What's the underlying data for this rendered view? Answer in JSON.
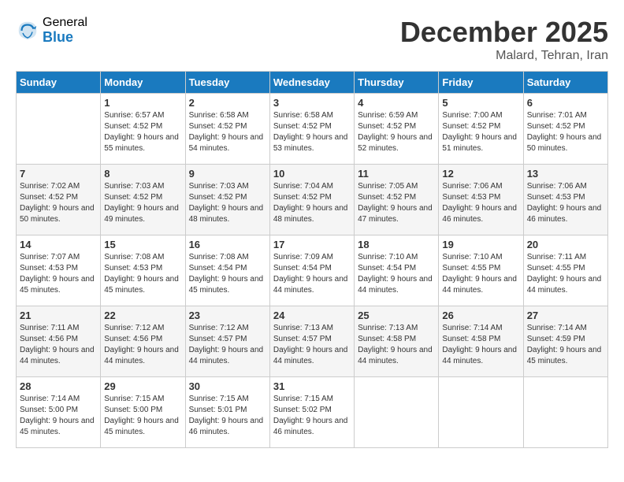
{
  "header": {
    "logo_general": "General",
    "logo_blue": "Blue",
    "month_title": "December 2025",
    "location": "Malard, Tehran, Iran"
  },
  "days_of_week": [
    "Sunday",
    "Monday",
    "Tuesday",
    "Wednesday",
    "Thursday",
    "Friday",
    "Saturday"
  ],
  "weeks": [
    [
      {
        "day": "",
        "sunrise": "",
        "sunset": "",
        "daylight": ""
      },
      {
        "day": "1",
        "sunrise": "Sunrise: 6:57 AM",
        "sunset": "Sunset: 4:52 PM",
        "daylight": "Daylight: 9 hours and 55 minutes."
      },
      {
        "day": "2",
        "sunrise": "Sunrise: 6:58 AM",
        "sunset": "Sunset: 4:52 PM",
        "daylight": "Daylight: 9 hours and 54 minutes."
      },
      {
        "day": "3",
        "sunrise": "Sunrise: 6:58 AM",
        "sunset": "Sunset: 4:52 PM",
        "daylight": "Daylight: 9 hours and 53 minutes."
      },
      {
        "day": "4",
        "sunrise": "Sunrise: 6:59 AM",
        "sunset": "Sunset: 4:52 PM",
        "daylight": "Daylight: 9 hours and 52 minutes."
      },
      {
        "day": "5",
        "sunrise": "Sunrise: 7:00 AM",
        "sunset": "Sunset: 4:52 PM",
        "daylight": "Daylight: 9 hours and 51 minutes."
      },
      {
        "day": "6",
        "sunrise": "Sunrise: 7:01 AM",
        "sunset": "Sunset: 4:52 PM",
        "daylight": "Daylight: 9 hours and 50 minutes."
      }
    ],
    [
      {
        "day": "7",
        "sunrise": "Sunrise: 7:02 AM",
        "sunset": "Sunset: 4:52 PM",
        "daylight": "Daylight: 9 hours and 50 minutes."
      },
      {
        "day": "8",
        "sunrise": "Sunrise: 7:03 AM",
        "sunset": "Sunset: 4:52 PM",
        "daylight": "Daylight: 9 hours and 49 minutes."
      },
      {
        "day": "9",
        "sunrise": "Sunrise: 7:03 AM",
        "sunset": "Sunset: 4:52 PM",
        "daylight": "Daylight: 9 hours and 48 minutes."
      },
      {
        "day": "10",
        "sunrise": "Sunrise: 7:04 AM",
        "sunset": "Sunset: 4:52 PM",
        "daylight": "Daylight: 9 hours and 48 minutes."
      },
      {
        "day": "11",
        "sunrise": "Sunrise: 7:05 AM",
        "sunset": "Sunset: 4:52 PM",
        "daylight": "Daylight: 9 hours and 47 minutes."
      },
      {
        "day": "12",
        "sunrise": "Sunrise: 7:06 AM",
        "sunset": "Sunset: 4:53 PM",
        "daylight": "Daylight: 9 hours and 46 minutes."
      },
      {
        "day": "13",
        "sunrise": "Sunrise: 7:06 AM",
        "sunset": "Sunset: 4:53 PM",
        "daylight": "Daylight: 9 hours and 46 minutes."
      }
    ],
    [
      {
        "day": "14",
        "sunrise": "Sunrise: 7:07 AM",
        "sunset": "Sunset: 4:53 PM",
        "daylight": "Daylight: 9 hours and 45 minutes."
      },
      {
        "day": "15",
        "sunrise": "Sunrise: 7:08 AM",
        "sunset": "Sunset: 4:53 PM",
        "daylight": "Daylight: 9 hours and 45 minutes."
      },
      {
        "day": "16",
        "sunrise": "Sunrise: 7:08 AM",
        "sunset": "Sunset: 4:54 PM",
        "daylight": "Daylight: 9 hours and 45 minutes."
      },
      {
        "day": "17",
        "sunrise": "Sunrise: 7:09 AM",
        "sunset": "Sunset: 4:54 PM",
        "daylight": "Daylight: 9 hours and 44 minutes."
      },
      {
        "day": "18",
        "sunrise": "Sunrise: 7:10 AM",
        "sunset": "Sunset: 4:54 PM",
        "daylight": "Daylight: 9 hours and 44 minutes."
      },
      {
        "day": "19",
        "sunrise": "Sunrise: 7:10 AM",
        "sunset": "Sunset: 4:55 PM",
        "daylight": "Daylight: 9 hours and 44 minutes."
      },
      {
        "day": "20",
        "sunrise": "Sunrise: 7:11 AM",
        "sunset": "Sunset: 4:55 PM",
        "daylight": "Daylight: 9 hours and 44 minutes."
      }
    ],
    [
      {
        "day": "21",
        "sunrise": "Sunrise: 7:11 AM",
        "sunset": "Sunset: 4:56 PM",
        "daylight": "Daylight: 9 hours and 44 minutes."
      },
      {
        "day": "22",
        "sunrise": "Sunrise: 7:12 AM",
        "sunset": "Sunset: 4:56 PM",
        "daylight": "Daylight: 9 hours and 44 minutes."
      },
      {
        "day": "23",
        "sunrise": "Sunrise: 7:12 AM",
        "sunset": "Sunset: 4:57 PM",
        "daylight": "Daylight: 9 hours and 44 minutes."
      },
      {
        "day": "24",
        "sunrise": "Sunrise: 7:13 AM",
        "sunset": "Sunset: 4:57 PM",
        "daylight": "Daylight: 9 hours and 44 minutes."
      },
      {
        "day": "25",
        "sunrise": "Sunrise: 7:13 AM",
        "sunset": "Sunset: 4:58 PM",
        "daylight": "Daylight: 9 hours and 44 minutes."
      },
      {
        "day": "26",
        "sunrise": "Sunrise: 7:14 AM",
        "sunset": "Sunset: 4:58 PM",
        "daylight": "Daylight: 9 hours and 44 minutes."
      },
      {
        "day": "27",
        "sunrise": "Sunrise: 7:14 AM",
        "sunset": "Sunset: 4:59 PM",
        "daylight": "Daylight: 9 hours and 45 minutes."
      }
    ],
    [
      {
        "day": "28",
        "sunrise": "Sunrise: 7:14 AM",
        "sunset": "Sunset: 5:00 PM",
        "daylight": "Daylight: 9 hours and 45 minutes."
      },
      {
        "day": "29",
        "sunrise": "Sunrise: 7:15 AM",
        "sunset": "Sunset: 5:00 PM",
        "daylight": "Daylight: 9 hours and 45 minutes."
      },
      {
        "day": "30",
        "sunrise": "Sunrise: 7:15 AM",
        "sunset": "Sunset: 5:01 PM",
        "daylight": "Daylight: 9 hours and 46 minutes."
      },
      {
        "day": "31",
        "sunrise": "Sunrise: 7:15 AM",
        "sunset": "Sunset: 5:02 PM",
        "daylight": "Daylight: 9 hours and 46 minutes."
      },
      {
        "day": "",
        "sunrise": "",
        "sunset": "",
        "daylight": ""
      },
      {
        "day": "",
        "sunrise": "",
        "sunset": "",
        "daylight": ""
      },
      {
        "day": "",
        "sunrise": "",
        "sunset": "",
        "daylight": ""
      }
    ]
  ]
}
